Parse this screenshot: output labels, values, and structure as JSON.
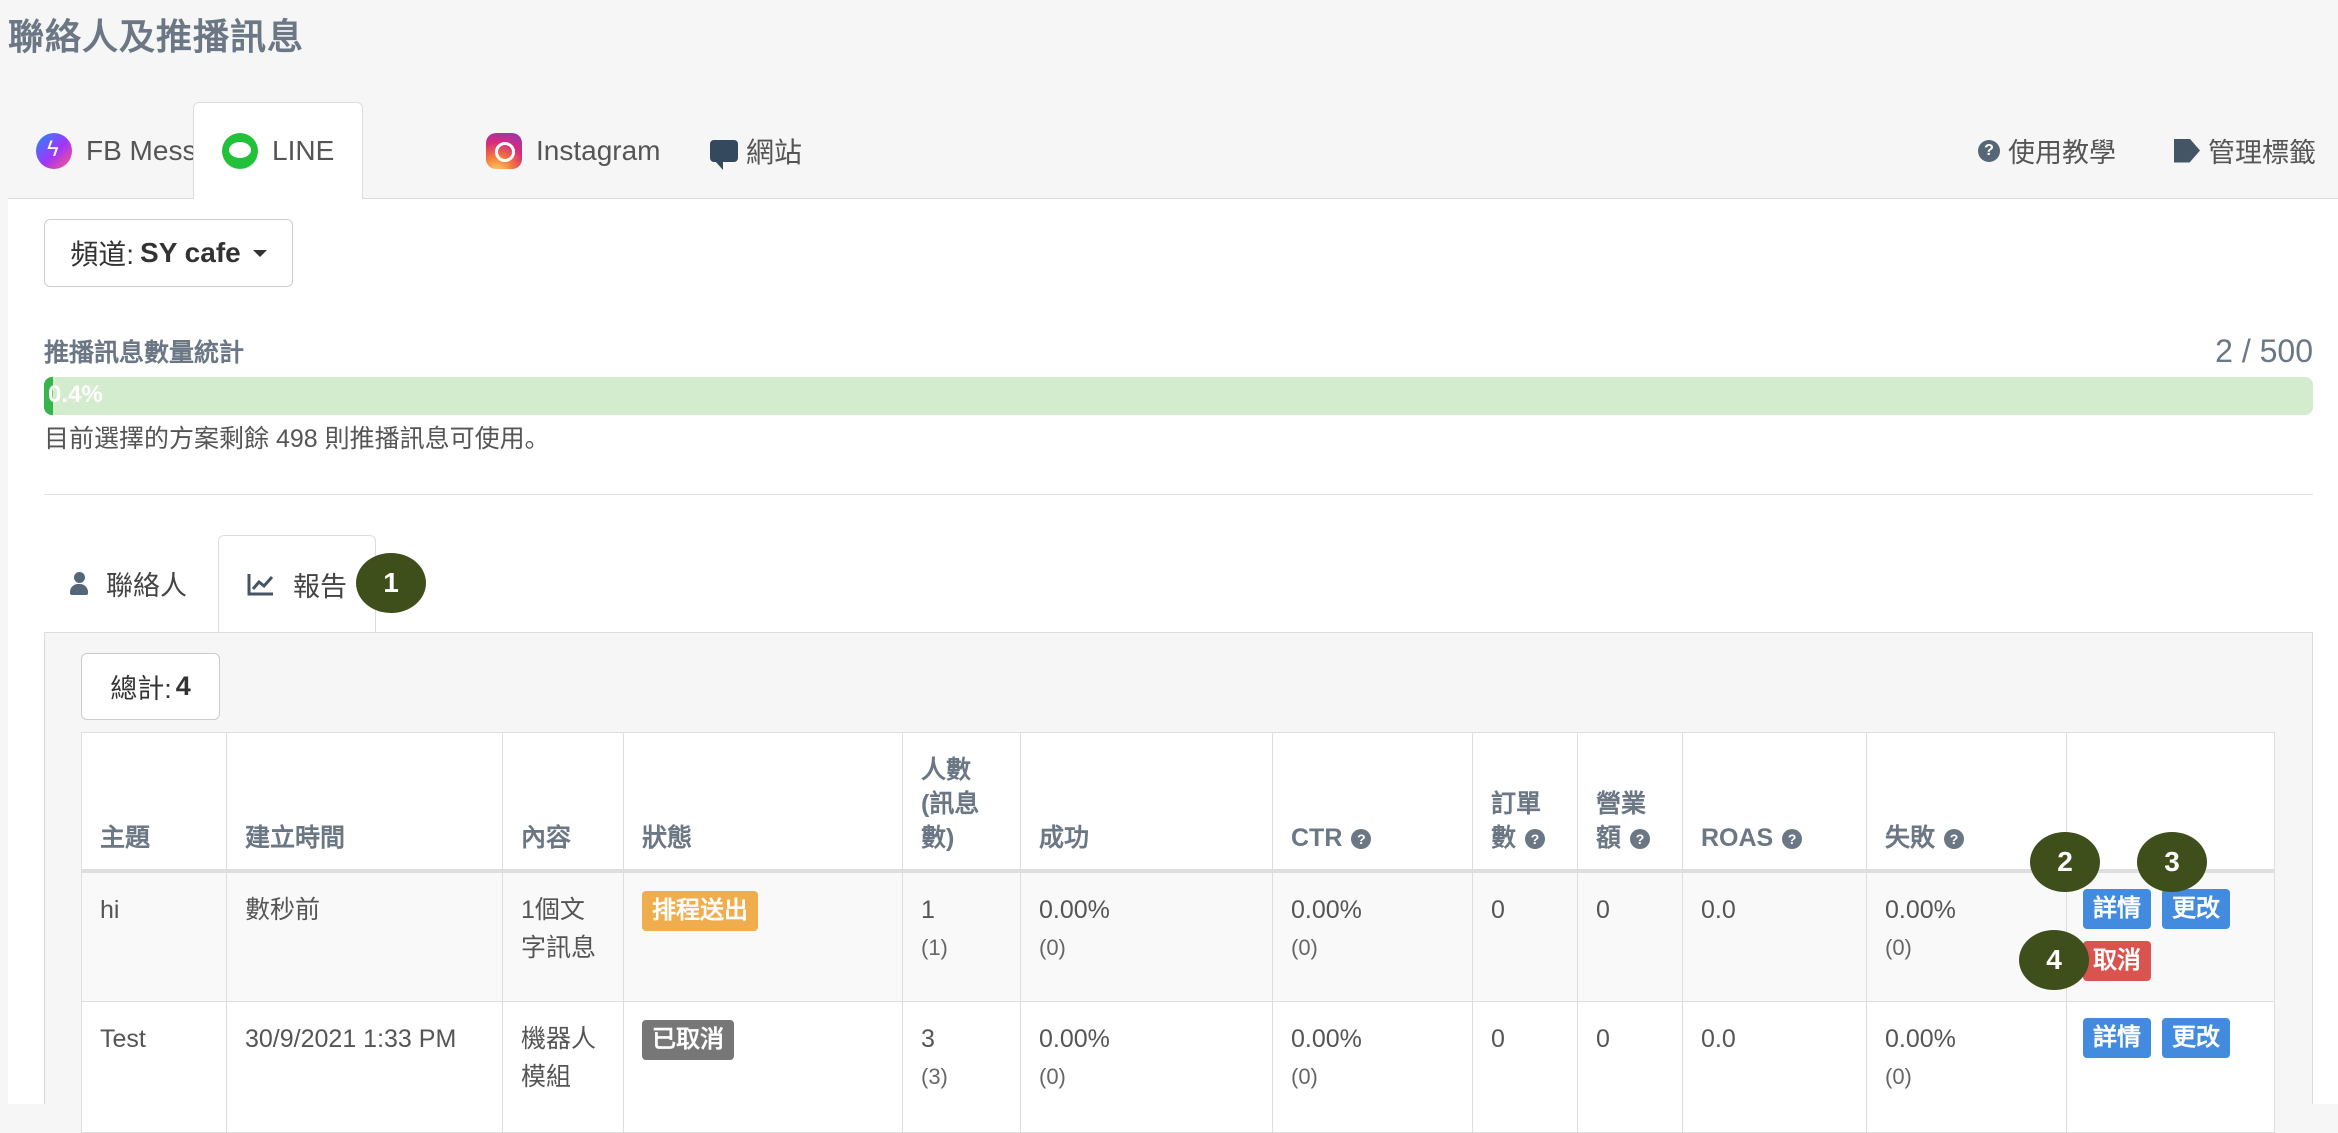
{
  "page": {
    "title": "聯絡人及推播訊息"
  },
  "channel_tabs": [
    {
      "label": "FB Messenger",
      "icon": "messenger-icon"
    },
    {
      "label": "LINE",
      "icon": "line-icon"
    },
    {
      "label": "Instagram",
      "icon": "instagram-icon"
    },
    {
      "label": "網站",
      "icon": "chat-icon"
    }
  ],
  "header_links": {
    "tutorial": "使用教學",
    "tags": "管理標籤"
  },
  "channel_select": {
    "prefix": "頻道:",
    "value": "SY cafe"
  },
  "stats": {
    "title": "推播訊息數量統計",
    "count": "2 / 500",
    "progress_label": "0.4%",
    "progress_fraction": 0.004,
    "remaining": "目前選擇的方案剩餘 498 則推播訊息可使用。"
  },
  "sub_tabs": {
    "contacts": "聯絡人",
    "report": "報告"
  },
  "total": {
    "label": "總計:",
    "value": "4"
  },
  "table": {
    "headers": {
      "subject": "主題",
      "created": "建立時間",
      "content": "內容",
      "status": "狀態",
      "people": "人數\n(訊息\n數)",
      "success": "成功",
      "ctr": "CTR",
      "orders": "訂單\n數",
      "revenue": "營業\n額",
      "roas": "ROAS",
      "failed": "失敗"
    },
    "rows": [
      {
        "subject": "hi",
        "created": "數秒前",
        "content": "1個文\n字訊息",
        "status": "排程送出",
        "people": "1",
        "people_sub": "(1)",
        "success": "0.00%",
        "success_sub": "(0)",
        "ctr": "0.00%",
        "ctr_sub": "(0)",
        "orders": "0",
        "revenue": "0",
        "roas": "0.0",
        "failed": "0.00%",
        "failed_sub": "(0)",
        "btn_details": "詳情",
        "btn_edit": "更改",
        "btn_cancel": "取消"
      },
      {
        "subject": "Test",
        "created": "30/9/2021 1:33 PM",
        "content": "機器人\n模組",
        "status": "已取消",
        "people": "3",
        "people_sub": "(3)",
        "success": "0.00%",
        "success_sub": "(0)",
        "ctr": "0.00%",
        "ctr_sub": "(0)",
        "orders": "0",
        "revenue": "0",
        "roas": "0.0",
        "failed": "0.00%",
        "failed_sub": "(0)",
        "btn_details": "詳情",
        "btn_edit": "更改"
      }
    ]
  },
  "markers": [
    "1",
    "2",
    "3",
    "4"
  ],
  "colors": {
    "line_green": "#22c13a",
    "progress_bg": "#d3eccd",
    "warning": "#f0ad4e",
    "danger": "#d9534f",
    "primary": "#428bdf",
    "marker": "#3e4f1c"
  }
}
